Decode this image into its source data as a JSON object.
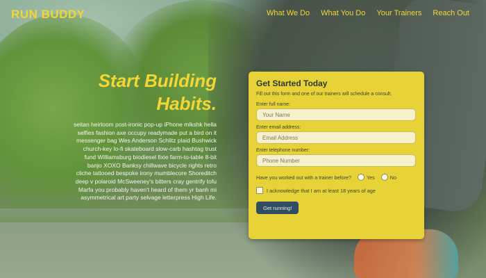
{
  "header": {
    "logo": "RUN BUDDY",
    "nav": [
      "What We Do",
      "What You Do",
      "Your Trainers",
      "Reach Out"
    ]
  },
  "hero": {
    "title_line1": "Start Building",
    "title_line2": "Habits.",
    "body": "seitan heirloom post-ironic pop-up iPhone mlkshk hella selfies fashion axe occupy readymade put a bird on it messenger bag Wes Anderson Schlitz plaid Bushwick church-key lo-fi skateboard slow-carb hashtag trust fund Williamsburg biodiesel fixie farm-to-table 8-bit banjo XOXO Banksy chillwave bicycle rights retro cliche tattooed bespoke irony mumblecore Shoreditch deep v polaroid McSweeney's bitters cray gentrify tofu Marfa you probably haven't heard of them yr banh mi asymmetrical art party selvage letterpress High Life."
  },
  "form": {
    "title": "Get Started Today",
    "intro": "Fill out this form and one of our trainers will schedule a consult.",
    "name_label": "Enter full name:",
    "name_placeholder": "Your Name",
    "email_label": "Enter email address:",
    "email_placeholder": "Email Address",
    "phone_label": "Enter telephone number:",
    "phone_placeholder": "Phone Number",
    "worked_out_question": "Have you worked out with a trainer before?",
    "option_yes": "Yes",
    "option_no": "No",
    "acknowledge": "I acknowledge that I am at least 18 years of age",
    "submit_label": "Get running!"
  },
  "colors": {
    "accent": "#f3d636",
    "card": "#e7d238",
    "button": "#2f4e63"
  }
}
